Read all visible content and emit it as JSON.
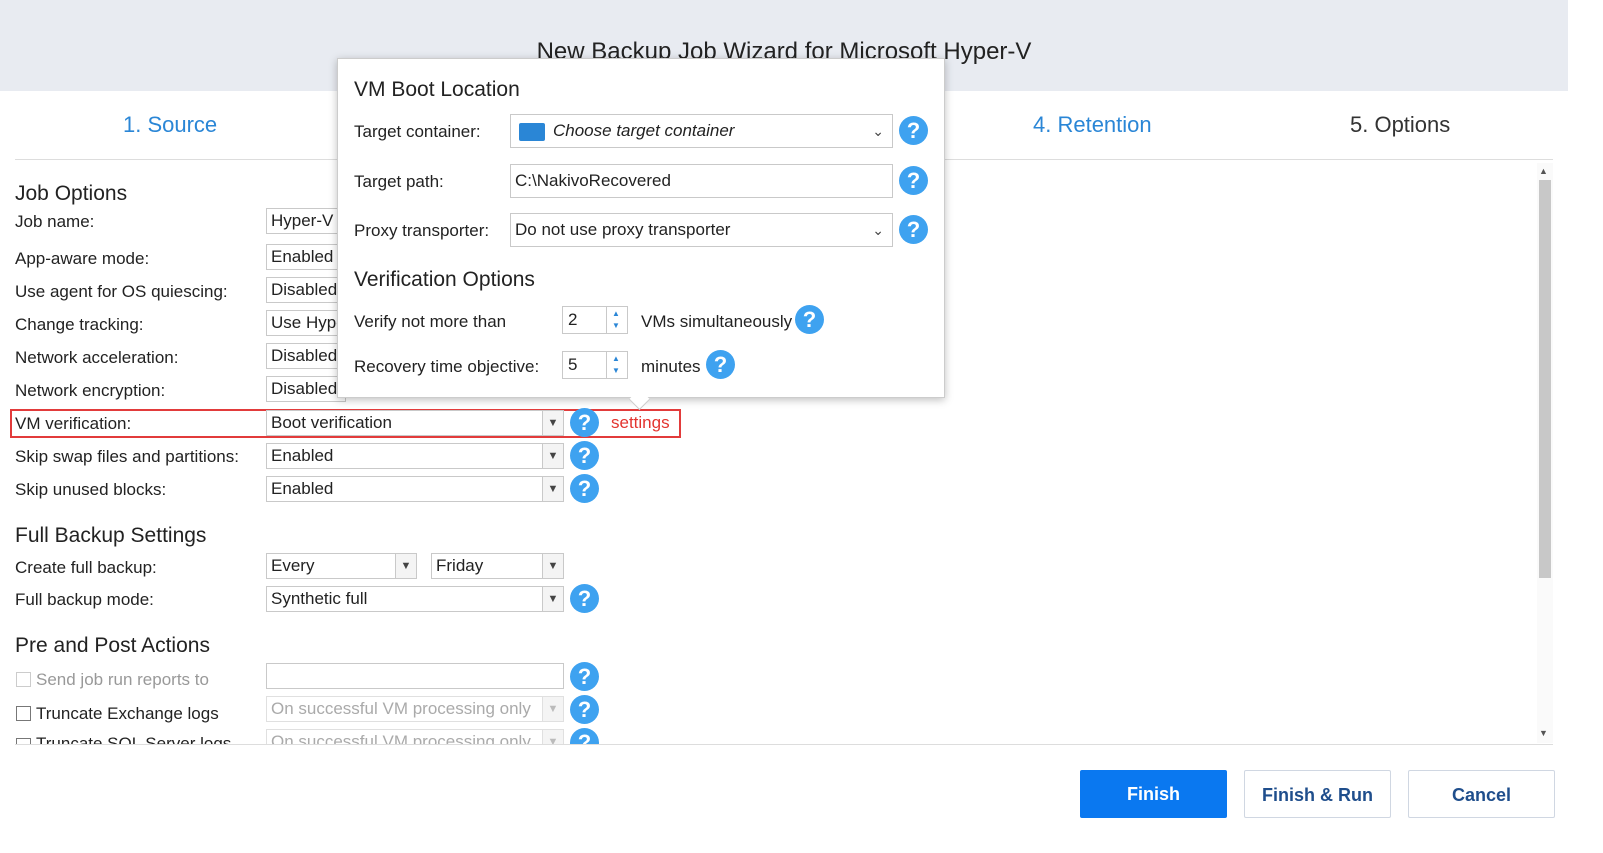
{
  "window": {
    "title": "New Backup Job Wizard for Microsoft Hyper-V"
  },
  "steps": [
    "1. Source",
    "4. Retention",
    "5. Options"
  ],
  "job_options": {
    "heading": "Job Options",
    "job_name": {
      "label": "Job name:",
      "value": "Hyper-V"
    },
    "app_aware": {
      "label": "App-aware mode:",
      "value": "Enabled"
    },
    "os_quiescing": {
      "label": "Use agent for OS quiescing:",
      "value": "Disabled"
    },
    "change_tracking": {
      "label": "Change tracking:",
      "value": "Use Hype"
    },
    "net_accel": {
      "label": "Network acceleration:",
      "value": "Disabled"
    },
    "net_encrypt": {
      "label": "Network encryption:",
      "value": "Disabled"
    },
    "vm_verification": {
      "label": "VM verification:",
      "value": "Boot verification",
      "settings_link": "settings"
    },
    "skip_swap": {
      "label": "Skip swap files and partitions:",
      "value": "Enabled"
    },
    "skip_unused": {
      "label": "Skip unused blocks:",
      "value": "Enabled"
    }
  },
  "full_backup": {
    "heading": "Full Backup Settings",
    "create": {
      "label": "Create full backup:",
      "value1": "Every",
      "value2": "Friday"
    },
    "mode": {
      "label": "Full backup mode:",
      "value": "Synthetic full"
    }
  },
  "pre_post": {
    "heading": "Pre and Post Actions",
    "send_reports": {
      "label": "Send job run reports to",
      "value": ""
    },
    "truncate_exchange": {
      "label": "Truncate Exchange logs",
      "value": "On successful VM processing only"
    },
    "truncate_sql": {
      "label": "Truncate SQL Server logs",
      "value": "On successful VM processing only"
    }
  },
  "popup": {
    "boot_heading": "VM Boot Location",
    "target_container": {
      "label": "Target container:",
      "placeholder": "Choose target container"
    },
    "target_path": {
      "label": "Target path:",
      "value": "C:\\NakivoRecovered"
    },
    "proxy": {
      "label": "Proxy transporter:",
      "value": "Do not use proxy transporter"
    },
    "verif_heading": "Verification Options",
    "verify_max": {
      "label": "Verify not more than",
      "value": "2",
      "suffix": "VMs simultaneously"
    },
    "rto": {
      "label": "Recovery time objective:",
      "value": "5",
      "suffix": "minutes"
    }
  },
  "buttons": {
    "finish": "Finish",
    "finish_run": "Finish & Run",
    "cancel": "Cancel"
  },
  "help_glyph": "?",
  "colors": {
    "accent": "#0a78f0",
    "link": "#2a86d6",
    "highlight": "#e23b3b",
    "help": "#3ea2f0"
  }
}
